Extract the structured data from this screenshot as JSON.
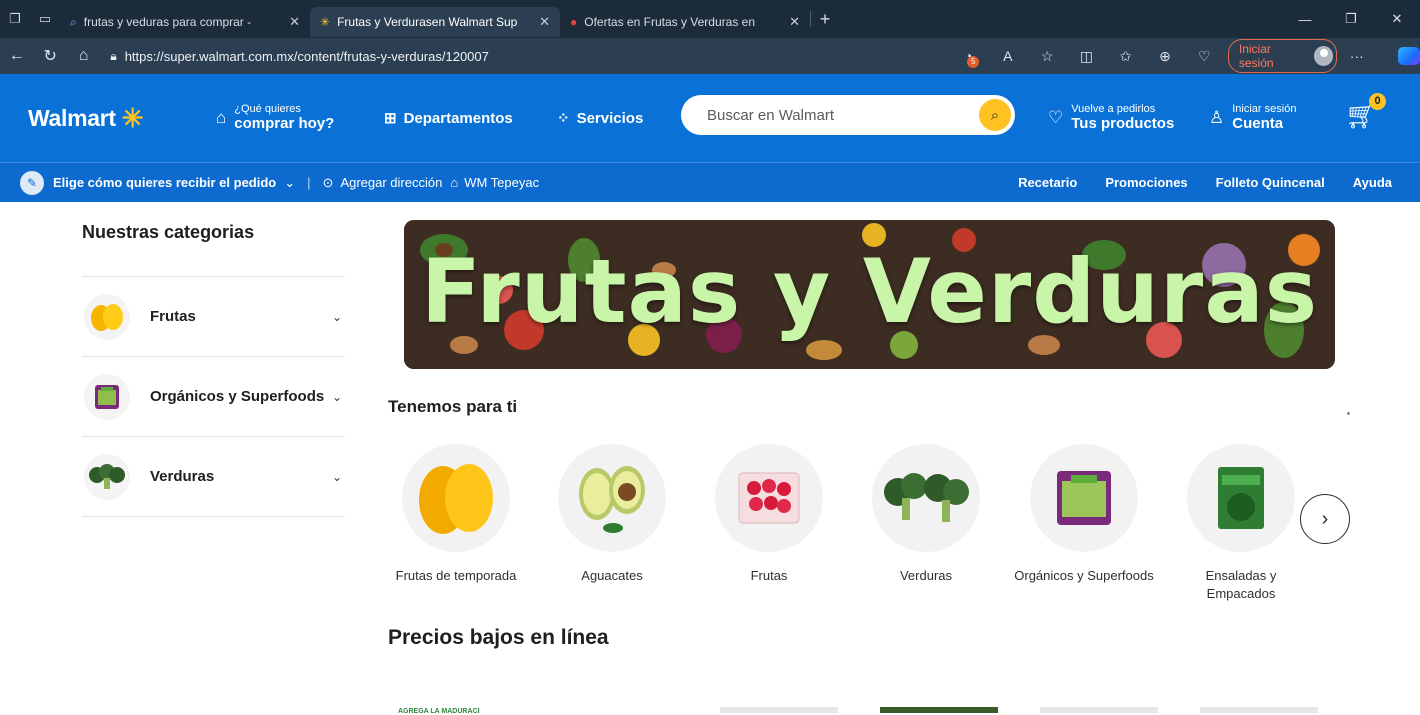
{
  "browser": {
    "tabs": [
      {
        "label": "frutas y veduras para comprar - "
      },
      {
        "label": "Frutas y Verdurasen Walmart Sup"
      },
      {
        "label": "Ofertas en Frutas y Verduras en"
      }
    ],
    "url": "https://super.walmart.com.mx/content/frutas-y-verduras/120007",
    "extension_badge": "5",
    "signin_label": "Iniciar sesión"
  },
  "header": {
    "logo": "Walmart",
    "shop_small": "¿Qué quieres",
    "shop_big": "comprar hoy?",
    "departments": "Departamentos",
    "services": "Servicios",
    "search_placeholder": "Buscar en Walmart",
    "reorder_small": "Vuelve a pedirlos",
    "reorder_big": "Tus productos",
    "account_small": "Iniciar sesión",
    "account_big": "Cuenta",
    "cart_count": "0"
  },
  "subbar": {
    "delivery": "Elige cómo quieres recibir el pedido",
    "address": "Agregar dirección",
    "store": "WM Tepeyac",
    "links": [
      "Recetario",
      "Promociones",
      "Folleto Quincenal",
      "Ayuda"
    ]
  },
  "sidebar": {
    "title": "Nuestras categorias",
    "items": [
      {
        "label": "Frutas"
      },
      {
        "label": "Orgánicos y Superfoods"
      },
      {
        "label": "Verduras"
      }
    ]
  },
  "banner": {
    "title": "Frutas y Verduras"
  },
  "section_for_you": {
    "title": "Tenemos para ti",
    "items": [
      {
        "label": "Frutas de temporada"
      },
      {
        "label": "Aguacates"
      },
      {
        "label": "Frutas"
      },
      {
        "label": "Verduras"
      },
      {
        "label": "Orgánicos y Superfoods"
      },
      {
        "label": "Ensaladas y Empacados"
      }
    ]
  },
  "section_low_prices": {
    "title": "Precios bajos en línea",
    "peek_text": "AGREGA LA MADURACI"
  },
  "colors": {
    "walmart_blue": "#0a71d6",
    "spark_yellow": "#ffc220",
    "browser_dark": "#1c2b3a"
  }
}
